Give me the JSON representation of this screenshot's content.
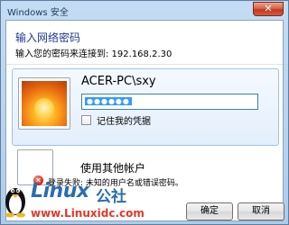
{
  "window": {
    "title": "Windows 安全",
    "close_glyph": "✕"
  },
  "dialog": {
    "heading": "输入网络密码",
    "subtext": "输入您的密码来连接到: 192.168.2.30"
  },
  "credential": {
    "username": "ACER-PC\\sxy",
    "password_mask": "●●●●●●",
    "remember_label": "记住我的凭据",
    "remember_checked": false,
    "avatar_icon": "flower-avatar-icon"
  },
  "other_account": {
    "label": "使用其他帐户"
  },
  "error": {
    "icon": "error-icon",
    "icon_glyph": "✕",
    "text": "登录失败: 未知的用户名或错误密码。"
  },
  "buttons": {
    "ok": "确定",
    "cancel": "取消"
  },
  "watermark": {
    "brand": "Linux",
    "brand_cn": "公社",
    "url": "www.Linuxidc.com"
  },
  "colors": {
    "heading": "#1f3a93",
    "selection": "#3399ff",
    "watermark_blue": "#2a6db0",
    "watermark_red": "#e0392a"
  }
}
